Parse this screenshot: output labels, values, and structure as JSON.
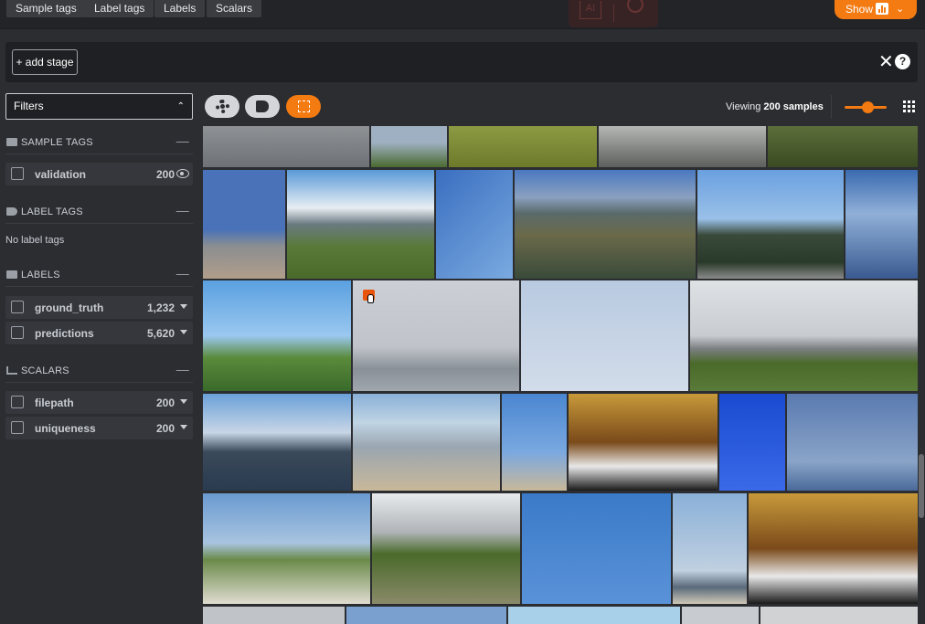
{
  "topbar": {
    "tabs": [
      "Sample tags",
      "Label tags",
      "Labels",
      "Scalars"
    ],
    "show_label": "Show",
    "ghost_ai": "AI"
  },
  "stagebar": {
    "add_stage_label": "+ add stage"
  },
  "sidebar": {
    "filters_label": "Filters",
    "sample_tags": {
      "title": "SAMPLE TAGS",
      "items": [
        {
          "name": "validation",
          "count": "200"
        }
      ]
    },
    "label_tags": {
      "title": "LABEL TAGS",
      "empty": "No label tags"
    },
    "labels": {
      "title": "LABELS",
      "items": [
        {
          "name": "ground_truth",
          "count": "1,232"
        },
        {
          "name": "predictions",
          "count": "5,620"
        }
      ]
    },
    "scalars": {
      "title": "SCALARS",
      "items": [
        {
          "name": "filepath",
          "count": "200"
        },
        {
          "name": "uniqueness",
          "count": "200"
        }
      ]
    }
  },
  "toolbar": {
    "viewing_prefix": "Viewing",
    "viewing_count": "200 samples"
  },
  "colors": {
    "accent": "#f47a12",
    "background": "#2b2d31",
    "panel": "#1f2023"
  }
}
